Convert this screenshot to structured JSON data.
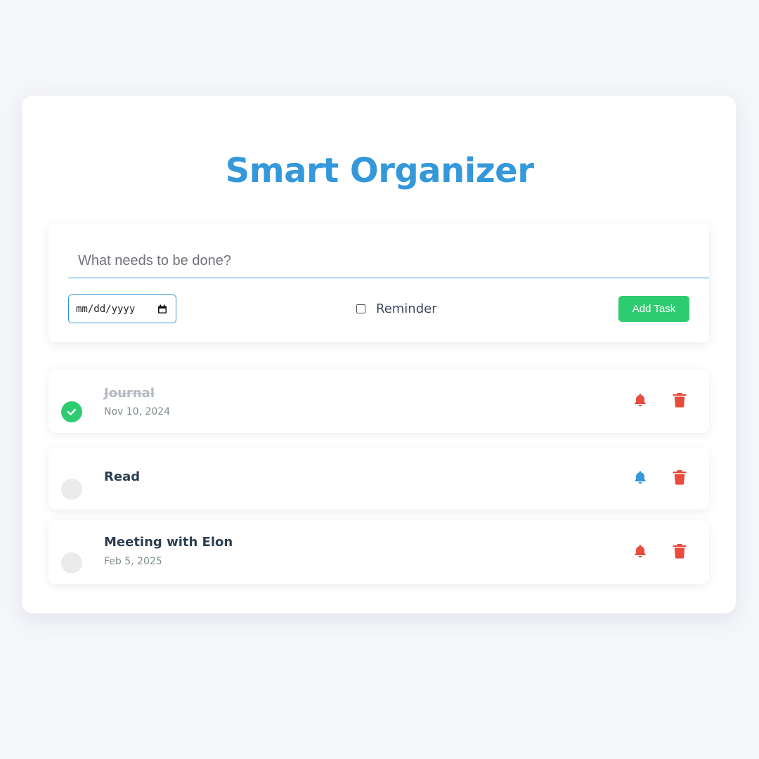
{
  "app": {
    "title": "Smart Organizer"
  },
  "form": {
    "task_placeholder": "What needs to be done?",
    "task_value": "",
    "date_placeholder": "mm/dd/yyyy",
    "reminder_label": "Reminder",
    "reminder_checked": false,
    "add_button_label": "Add Task"
  },
  "tasks": [
    {
      "name": "Journal",
      "date": "Nov 10, 2024",
      "completed": true,
      "reminder_active": false,
      "reminder_icon": "bell-icon",
      "delete_icon": "trash-icon"
    },
    {
      "name": "Read",
      "date": "",
      "completed": false,
      "reminder_active": true,
      "reminder_icon": "bell-icon",
      "delete_icon": "trash-icon"
    },
    {
      "name": "Meeting with Elon",
      "date": "Feb 5, 2025",
      "completed": false,
      "reminder_active": false,
      "reminder_icon": "bell-icon",
      "delete_icon": "trash-icon"
    }
  ],
  "colors": {
    "accent_blue": "#3498db",
    "success_green": "#2ecc71",
    "danger_red": "#e74c3c",
    "text_dark": "#2c3e50",
    "background": "#f5f6fa"
  }
}
